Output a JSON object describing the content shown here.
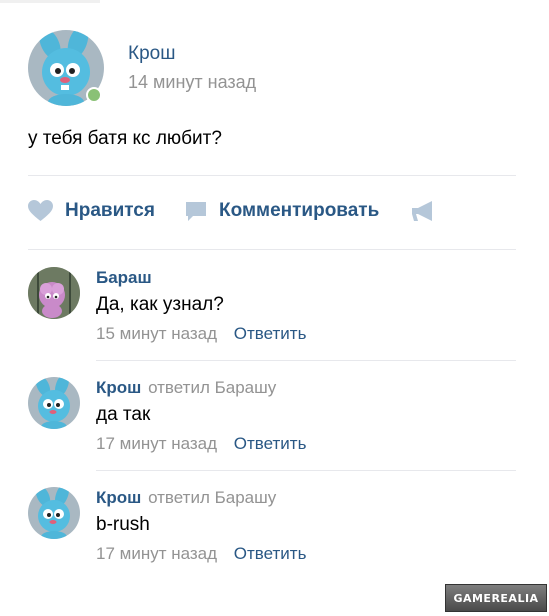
{
  "post": {
    "author": "Крош",
    "time": "14 минут назад",
    "text": "у тебя батя кс любит?",
    "online": true
  },
  "actions": {
    "like_label": "Нравится",
    "comment_label": "Комментировать"
  },
  "comments": [
    {
      "author": "Бараш",
      "reply_to": "",
      "text": "Да, как узнал?",
      "time": "15 минут назад",
      "reply_label": "Ответить"
    },
    {
      "author": "Крош",
      "reply_to": "ответил Барашу",
      "text": "да так",
      "time": "17 минут назад",
      "reply_label": "Ответить"
    },
    {
      "author": "Крош",
      "reply_to": "ответил Барашу",
      "text": "b-rush",
      "time": "17 минут назад",
      "reply_label": "Ответить"
    }
  ],
  "watermark": "GAMEREALIA",
  "colors": {
    "link": "#2a5885",
    "muted": "#939393",
    "divider": "#e7e8ec",
    "icon": "#b5c7d9",
    "online": "#8ac176"
  }
}
